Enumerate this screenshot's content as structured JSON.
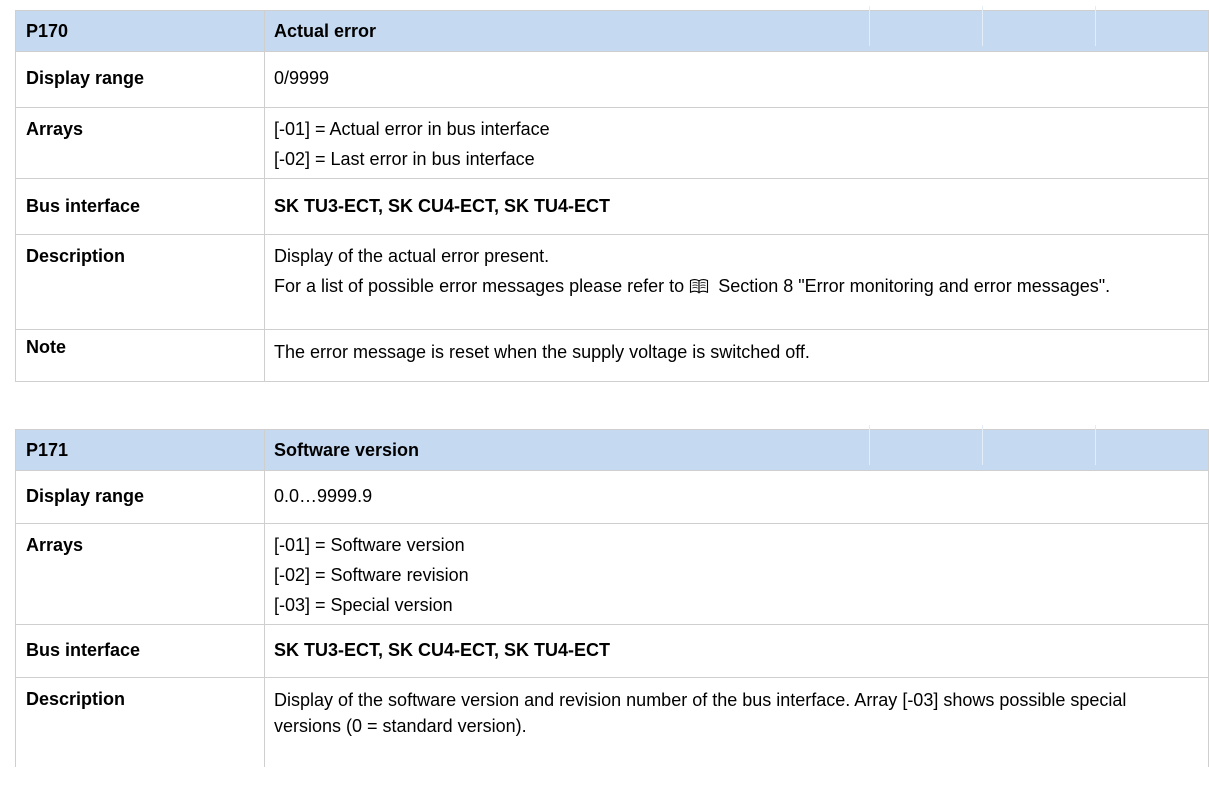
{
  "p170": {
    "code": "P170",
    "title": "Actual error",
    "display_range": {
      "label": "Display range",
      "value": "0/9999"
    },
    "arrays": {
      "label": "Arrays",
      "items": [
        "[-01] = Actual error in bus interface",
        "[-02] = Last error in bus interface"
      ]
    },
    "bus_interface": {
      "label": "Bus interface",
      "value": "SK TU3-ECT, SK CU4-ECT, SK TU4-ECT"
    },
    "description": {
      "label": "Description",
      "line1": "Display of the actual error present.",
      "line2_prefix": "For a list of possible error messages please refer to",
      "line2_ref": "Section 8 \"Error monitoring and error messages\"."
    },
    "note": {
      "label": "Note",
      "value": "The error message is reset when the supply voltage is switched off."
    }
  },
  "p171": {
    "code": "P171",
    "title": "Software version",
    "display_range": {
      "label": "Display range",
      "value": "0.0…9999.9"
    },
    "arrays": {
      "label": "Arrays",
      "items": [
        "[-01] = Software version",
        "[-02] = Software revision",
        "[-03] = Special version"
      ]
    },
    "bus_interface": {
      "label": "Bus interface",
      "value": "SK TU3-ECT, SK CU4-ECT, SK TU4-ECT"
    },
    "description": {
      "label": "Description",
      "value": "Display of the software version and revision number of the bus interface. Array [-03] shows possible special versions (0 = standard version)."
    }
  },
  "icons": {
    "reference": "book-icon"
  },
  "colors": {
    "header_background": "#c5d9f1",
    "border": "#cfcfcf"
  }
}
